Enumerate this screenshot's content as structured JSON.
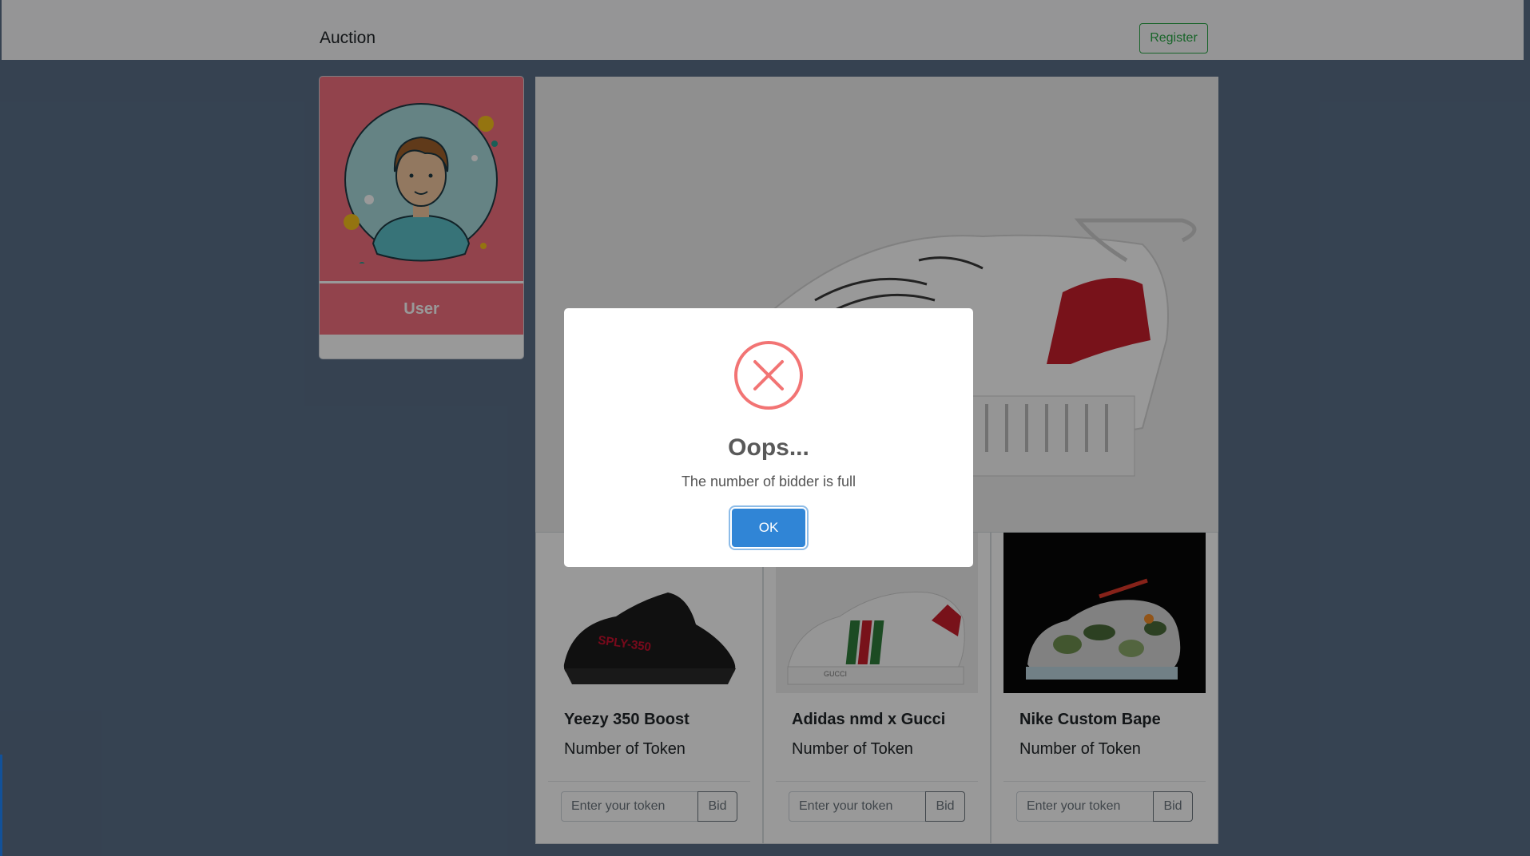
{
  "navbar": {
    "brand": "Auction",
    "register_label": "Register"
  },
  "user_card": {
    "name": "User"
  },
  "products": [
    {
      "title": "Yeezy 350 Boost",
      "token_label": "Number of Token",
      "input_placeholder": "Enter your token",
      "bid_label": "Bid",
      "image_icon": "sneaker-black-image"
    },
    {
      "title": "Adidas nmd x Gucci",
      "token_label": "Number of Token",
      "input_placeholder": "Enter your token",
      "bid_label": "Bid",
      "image_icon": "sneaker-white-stripe-image"
    },
    {
      "title": "Nike Custom Bape",
      "token_label": "Number of Token",
      "input_placeholder": "Enter your token",
      "bid_label": "Bid",
      "image_icon": "sneaker-camo-image"
    }
  ],
  "modal": {
    "title": "Oops...",
    "text": "The number of bidder is full",
    "ok_label": "OK",
    "icon": "error-x-icon"
  },
  "colors": {
    "accent_blue": "#3085d6",
    "error_red": "#f27474",
    "register_green": "#28a745",
    "card_pink": "#f4717f",
    "page_bg": "#5a6f88"
  }
}
